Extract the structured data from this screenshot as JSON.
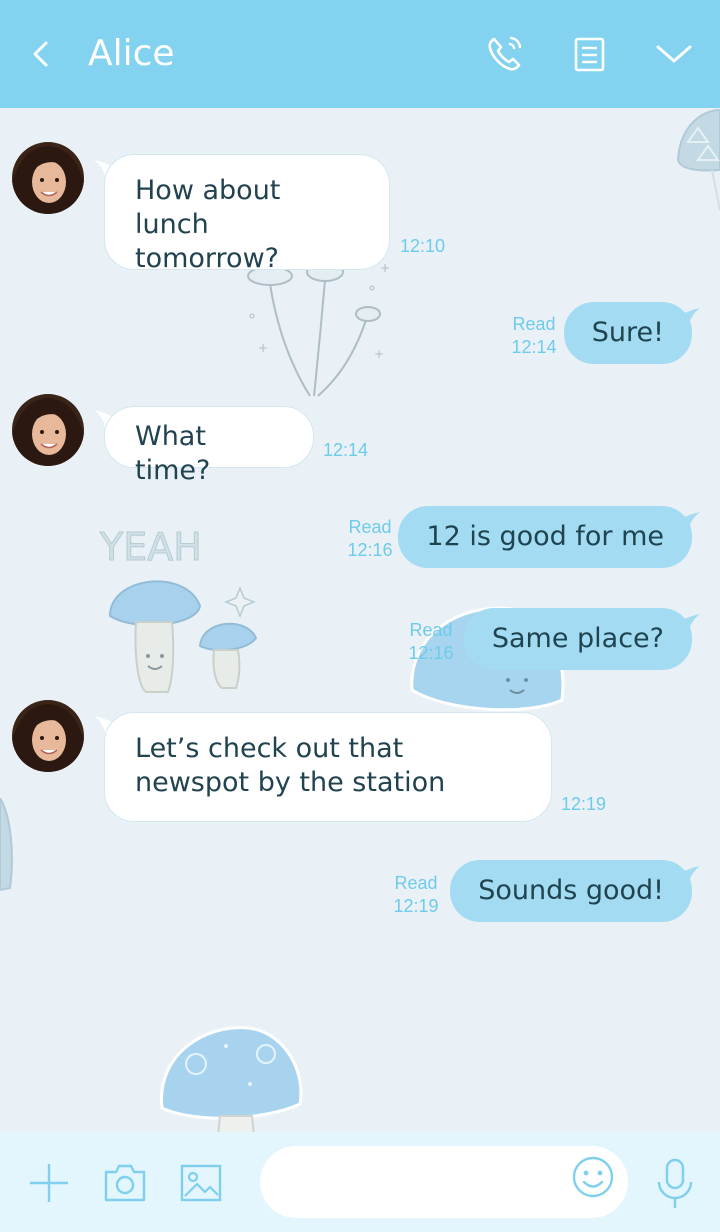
{
  "header": {
    "title": "Alice",
    "icons": [
      "back-chevron-icon",
      "phone-icon",
      "notes-icon",
      "chevron-down-icon"
    ]
  },
  "messages": [
    {
      "direction": "in",
      "text": "How about lunch tomorrow?",
      "time": "12:10"
    },
    {
      "direction": "out",
      "text": "Sure!",
      "status": "Read",
      "time": "12:14"
    },
    {
      "direction": "in",
      "text": "What time?",
      "time": "12:14"
    },
    {
      "direction": "out",
      "text": "12 is good for me",
      "status": "Read",
      "time": "12:16"
    },
    {
      "direction": "out",
      "text": "Same place?",
      "status": "Read",
      "time": "12:16"
    },
    {
      "direction": "in",
      "text": "Let’s check out that newspot by the station",
      "time": "12:19"
    },
    {
      "direction": "out",
      "text": "Sounds good!",
      "status": "Read",
      "time": "12:19"
    }
  ],
  "decorations": {
    "sticker_text": "YEAH"
  },
  "input": {
    "placeholder": "",
    "icons": [
      "plus-icon",
      "camera-icon",
      "image-icon",
      "emoji-icon",
      "microphone-icon"
    ]
  },
  "colors": {
    "header": "#82d2f0",
    "background": "#e9f1f6",
    "outgoing_bubble": "#a3dcf2",
    "incoming_bubble": "#ffffff",
    "meta_text": "#6ecbea",
    "input_bar": "#e3f5fd"
  }
}
